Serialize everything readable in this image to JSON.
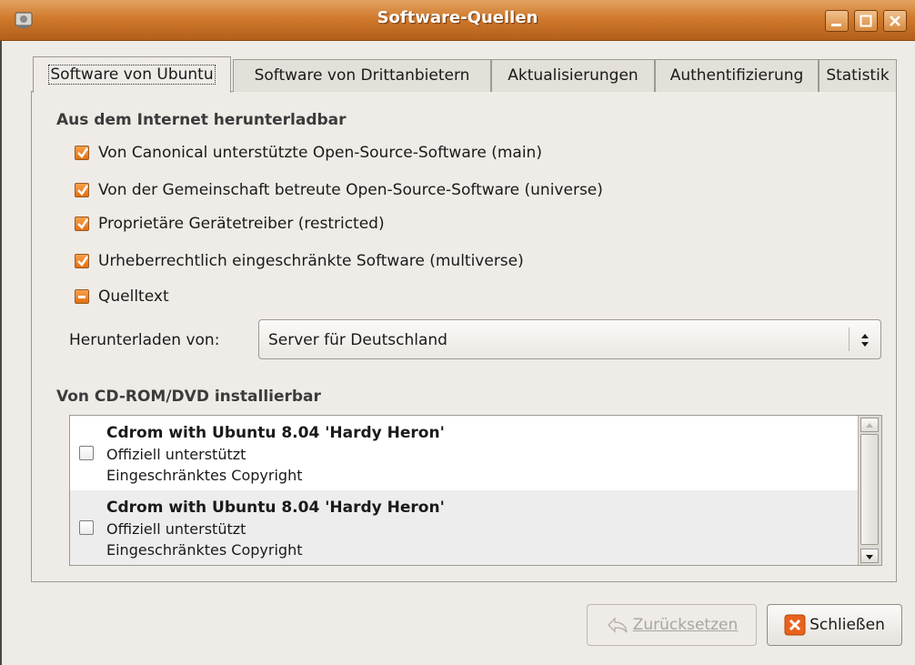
{
  "window": {
    "title": "Software-Quellen",
    "accent": "#d07a2c"
  },
  "tabs": [
    {
      "label": "Software von Ubuntu",
      "active": true
    },
    {
      "label": "Software von Drittanbietern",
      "active": false
    },
    {
      "label": "Aktualisierungen",
      "active": false
    },
    {
      "label": "Authentifizierung",
      "active": false
    },
    {
      "label": "Statistik",
      "active": false
    }
  ],
  "internet": {
    "heading": "Aus dem Internet herunterladbar",
    "items": [
      {
        "label": "Von Canonical unterstützte Open-Source-Software (main)",
        "state": "checked"
      },
      {
        "label": "Von der Gemeinschaft betreute Open-Source-Software (universe)",
        "state": "checked"
      },
      {
        "label": "Proprietäre Gerätetreiber (restricted)",
        "state": "checked"
      },
      {
        "label": "Urheberrechtlich eingeschränkte Software (multiverse)",
        "state": "checked"
      },
      {
        "label": "Quelltext",
        "state": "mixed"
      }
    ],
    "download_label": "Herunterladen von:",
    "download_value": "Server für Deutschland"
  },
  "cdrom": {
    "heading": "Von CD-ROM/DVD installierbar",
    "items": [
      {
        "title": "Cdrom with Ubuntu 8.04 'Hardy Heron'",
        "line2": "Offiziell unterstützt",
        "line3": "Eingeschränktes Copyright",
        "checked": false
      },
      {
        "title": "Cdrom with Ubuntu 8.04 'Hardy Heron'",
        "line2": "Offiziell unterstützt",
        "line3": "Eingeschränktes Copyright",
        "checked": false
      }
    ]
  },
  "buttons": {
    "revert": "Zurücksetzen",
    "close": "Schließen"
  }
}
